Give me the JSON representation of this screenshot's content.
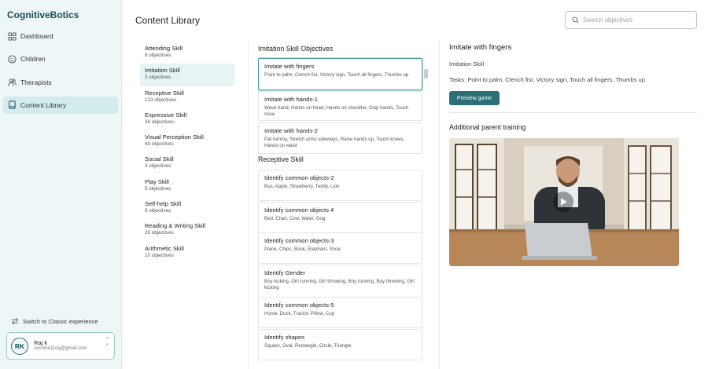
{
  "app": {
    "brand": "CognitiveBotics"
  },
  "sidebar": {
    "items": [
      {
        "label": "Dashboard",
        "icon": "grid-icon",
        "active": false
      },
      {
        "label": "Children",
        "icon": "smiley-icon",
        "active": false
      },
      {
        "label": "Therapists",
        "icon": "people-icon",
        "active": false
      },
      {
        "label": "Content Library",
        "icon": "book-icon",
        "active": true
      }
    ],
    "switch_label": "Switch to Classic experience",
    "user": {
      "initials": "RK",
      "name": "Raj k",
      "email": "cocome11raj@gmail.com"
    }
  },
  "header": {
    "title": "Content Library",
    "search_placeholder": "Search objectives"
  },
  "categories": [
    {
      "name": "Attending Skill",
      "count": "8 objectives"
    },
    {
      "name": "Imitation Skill",
      "count": "3 objectives",
      "active": true
    },
    {
      "name": "Receptive Skill",
      "count": "123 objectives"
    },
    {
      "name": "Expressive Skill",
      "count": "34 objectives"
    },
    {
      "name": "Visual Perception Skill",
      "count": "49 objectives"
    },
    {
      "name": "Social Skill",
      "count": "3 objectives"
    },
    {
      "name": "Play Skill",
      "count": "5 objectives"
    },
    {
      "name": "Self-help Skill",
      "count": "9 objectives"
    },
    {
      "name": "Reading & Writing Skill",
      "count": "28 objectives"
    },
    {
      "name": "Arithmetic Skill",
      "count": "10 objectives"
    }
  ],
  "objectives": {
    "imitation_title": "Imitation Skill Objectives",
    "imitation": [
      {
        "title": "Imitate with fingers",
        "desc": "Point to palm, Clench fist, Victory sign, Touch all fingers, Thumbs up"
      },
      {
        "title": "Imitate with hands-1",
        "desc": "Wave hand, Hands on head, Hands on shoulder, Clap hands, Touch nose"
      },
      {
        "title": "Imitate with hands-2",
        "desc": "Pat tummy, Stretch arms sideways, Raise hands up, Touch knees, Hands on waist"
      }
    ],
    "receptive_title": "Receptive Skill",
    "receptive": [
      {
        "title": "Identify common objects-2",
        "desc": "Bus, Apple, Strawberry, Teddy, Lion"
      },
      {
        "title": "Identify common objects 4",
        "desc": "Bed, Chair, Cow, Water, Dog"
      },
      {
        "title": "Identify common objects-3",
        "desc": "Plane, Chips, Book, Elephant, Shoe"
      },
      {
        "title": "Identify Gender",
        "desc": "Boy kicking, Girl running, Girl throwing, Boy running, Boy throwing, Girl kicking"
      },
      {
        "title": "Identify common objects-5",
        "desc": "Horse, Duck, Tractor, Pillow, Cup"
      },
      {
        "title": "Identify shapes",
        "desc": "Square, Oval, Rectangle, Circle, Triangle"
      }
    ]
  },
  "detail": {
    "title": "Imitate with fingers",
    "category": "Imitation Skill",
    "tasks": "Tasks: Point to palm, Clench fist, Victory sign, Touch all fingers, Thumbs up",
    "preview_label": "Preview game",
    "training_title": "Additional parent training"
  },
  "colors": {
    "accent": "#2b6f77",
    "sidebar_bg": "#eef7f8",
    "active_nav": "#d2ecee"
  }
}
